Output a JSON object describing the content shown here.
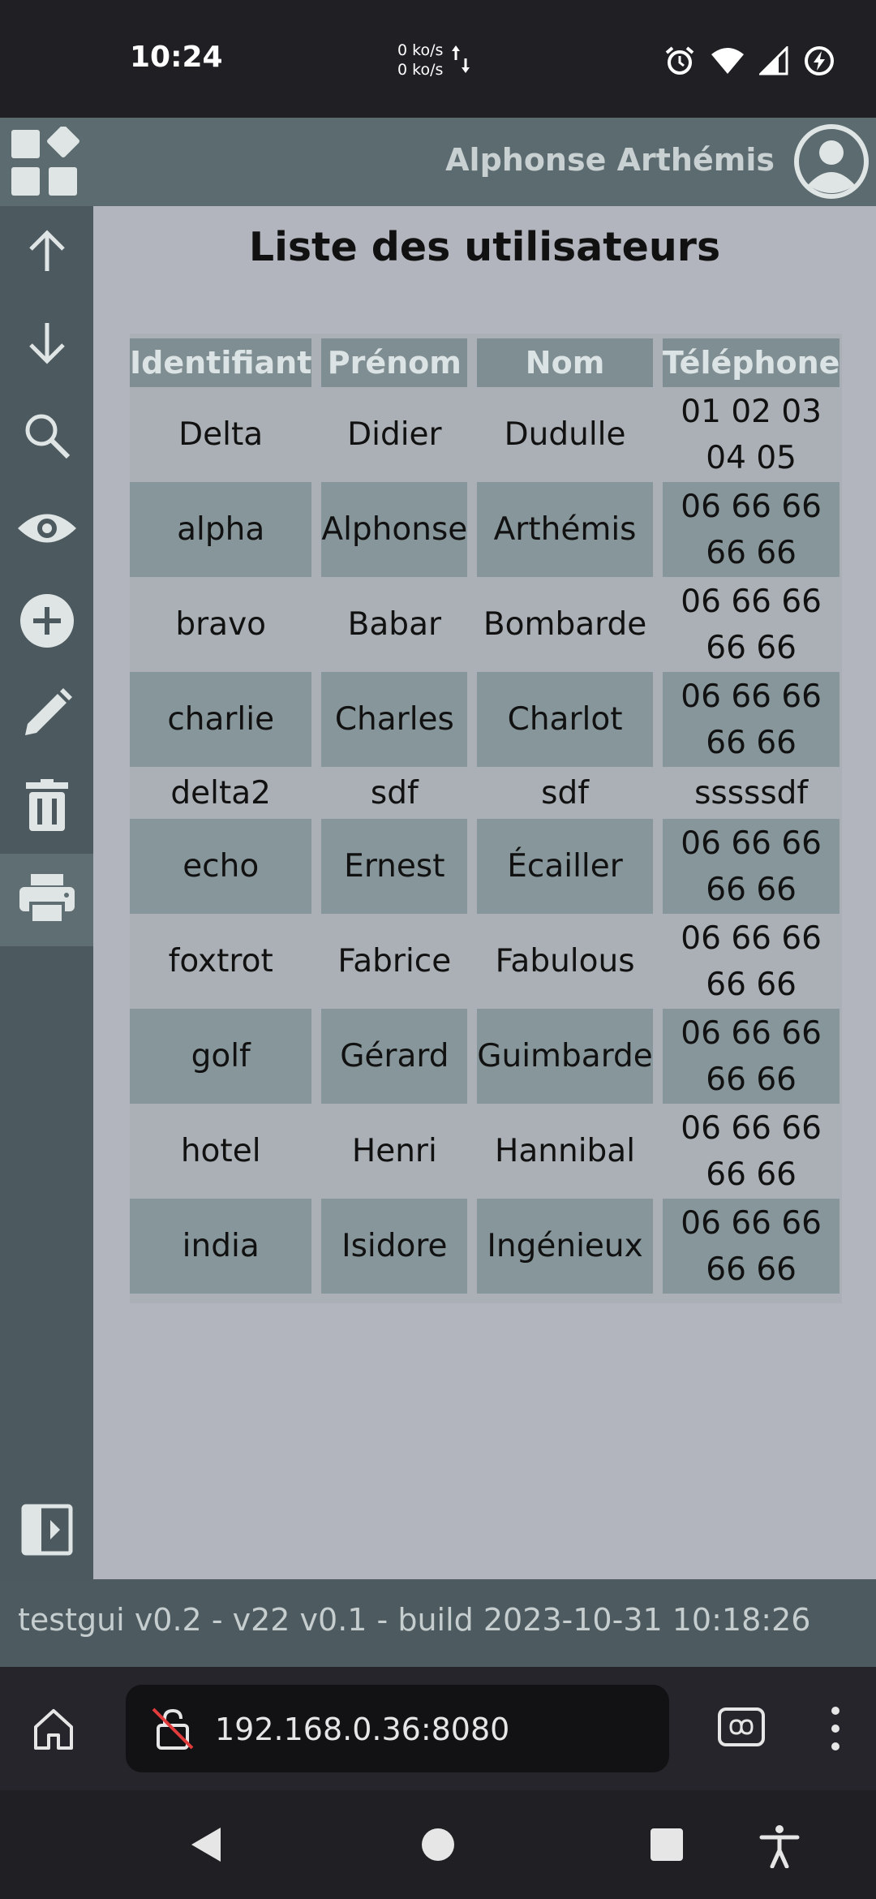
{
  "status": {
    "time": "10:24",
    "net_up": "0 ko/s",
    "net_down": "0 ko/s"
  },
  "header": {
    "user_name": "Alphonse Arthémis"
  },
  "sidebar": {
    "items": [
      {
        "icon": "arrow-up-icon"
      },
      {
        "icon": "arrow-down-icon"
      },
      {
        "icon": "search-icon"
      },
      {
        "icon": "eye-icon"
      },
      {
        "icon": "add-circle-icon"
      },
      {
        "icon": "pencil-icon"
      },
      {
        "icon": "trash-icon"
      },
      {
        "icon": "printer-icon",
        "active": true
      }
    ],
    "collapse_icon": "panel-collapse-icon"
  },
  "page": {
    "title": "Liste des utilisateurs"
  },
  "table": {
    "headers": [
      "Identifiant",
      "Prénom",
      "Nom",
      "Téléphone"
    ],
    "rows": [
      {
        "id": "Delta",
        "first": "Didier",
        "last": "Dudulle",
        "phone": "01 02 03 04 05"
      },
      {
        "id": "alpha",
        "first": "Alphonse",
        "last": "Arthémis",
        "phone": "06 66 66 66 66"
      },
      {
        "id": "bravo",
        "first": "Babar",
        "last": "Bombarde",
        "phone": "06 66 66 66 66"
      },
      {
        "id": "charlie",
        "first": "Charles",
        "last": "Charlot",
        "phone": "06 66 66 66 66"
      },
      {
        "id": "delta2",
        "first": "sdf",
        "last": "sdf",
        "phone": "sssssdf"
      },
      {
        "id": "echo",
        "first": "Ernest",
        "last": "Écailler",
        "phone": "06 66 66 66 66"
      },
      {
        "id": "foxtrot",
        "first": "Fabrice",
        "last": "Fabulous",
        "phone": "06 66 66 66 66"
      },
      {
        "id": "golf",
        "first": "Gérard",
        "last": "Guimbarde",
        "phone": "06 66 66 66 66"
      },
      {
        "id": "hotel",
        "first": "Henri",
        "last": "Hannibal",
        "phone": "06 66 66 66 66"
      },
      {
        "id": "india",
        "first": "Isidore",
        "last": "Ingénieux",
        "phone": "06 66 66 66 66"
      }
    ]
  },
  "footer": {
    "text": "testgui v0.2 - v22 v0.1 - build 2023-10-31 10:18:26"
  },
  "browser": {
    "url": "192.168.0.36:8080"
  },
  "colors": {
    "header_bg": "#5b6b6f",
    "sidebar_bg": "#4c5a5f",
    "content_bg": "#b2b5bd",
    "stripe_bg": "#87969a"
  }
}
